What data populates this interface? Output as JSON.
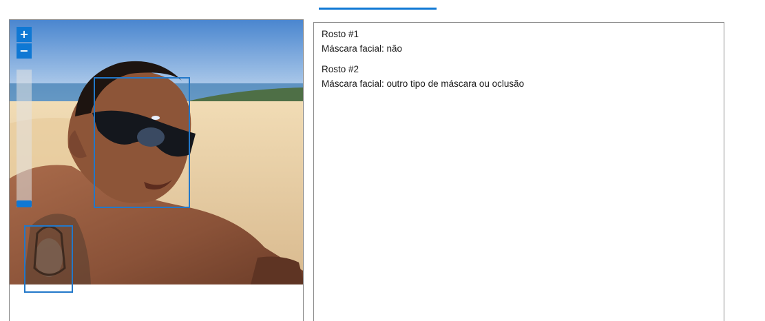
{
  "colors": {
    "accent": "#0f78d4",
    "face_box": "#2278c9"
  },
  "zoom": {
    "in_label": "+",
    "out_label": "−",
    "level": 0
  },
  "faces": [
    {
      "title": "Rosto #1",
      "mask_label": "Máscara facial: não"
    },
    {
      "title": "Rosto #2",
      "mask_label": "Máscara facial: outro tipo de máscara ou oclusão"
    }
  ]
}
